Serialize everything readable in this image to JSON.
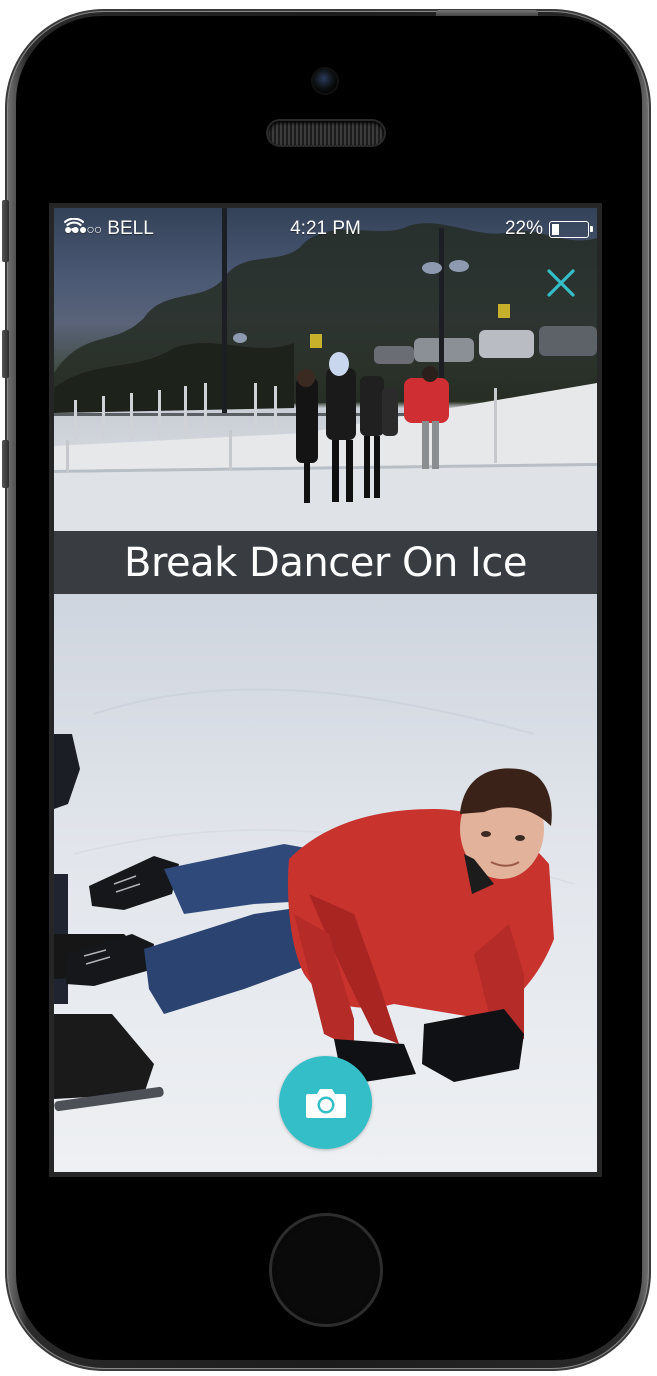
{
  "status_bar": {
    "signal": "●●●○○",
    "carrier": "BELL",
    "time": "4:21 PM",
    "battery": "22%",
    "battery_level": 0.22
  },
  "post": {
    "title": "Break Dancer On Ice"
  },
  "icons": {
    "close": "close-icon",
    "camera": "camera-icon",
    "wifi": "wifi-icon",
    "battery": "battery-icon"
  },
  "colors": {
    "accent": "#34bfc8",
    "title_bar": "#393d42",
    "title_text": "#ffffff"
  }
}
